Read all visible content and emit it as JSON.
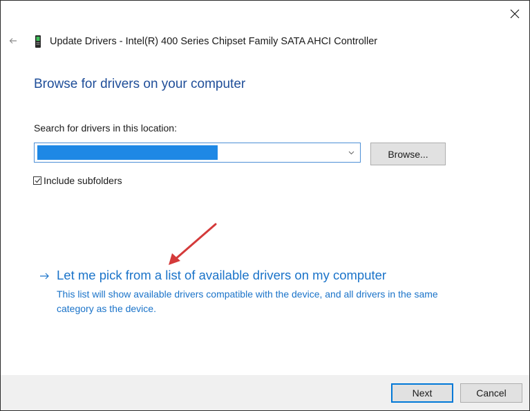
{
  "window": {
    "title": "Update Drivers - Intel(R) 400 Series Chipset Family SATA AHCI Controller"
  },
  "page": {
    "heading": "Browse for drivers on your computer",
    "search_label": "Search for drivers in this location:",
    "path_value": "",
    "browse_label": "Browse...",
    "include_subfolders_label": "Include subfolders",
    "include_subfolders_checked": true
  },
  "pick_option": {
    "title": "Let me pick from a list of available drivers on my computer",
    "description": "This list will show available drivers compatible with the device, and all drivers in the same category as the device."
  },
  "footer": {
    "next_label": "Next",
    "cancel_label": "Cancel"
  },
  "colors": {
    "heading": "#1f4e99",
    "link": "#1a73c9",
    "selection": "#1e88e5",
    "annotation_arrow": "#d43a3a",
    "footer_bg": "#f0f0f0"
  }
}
